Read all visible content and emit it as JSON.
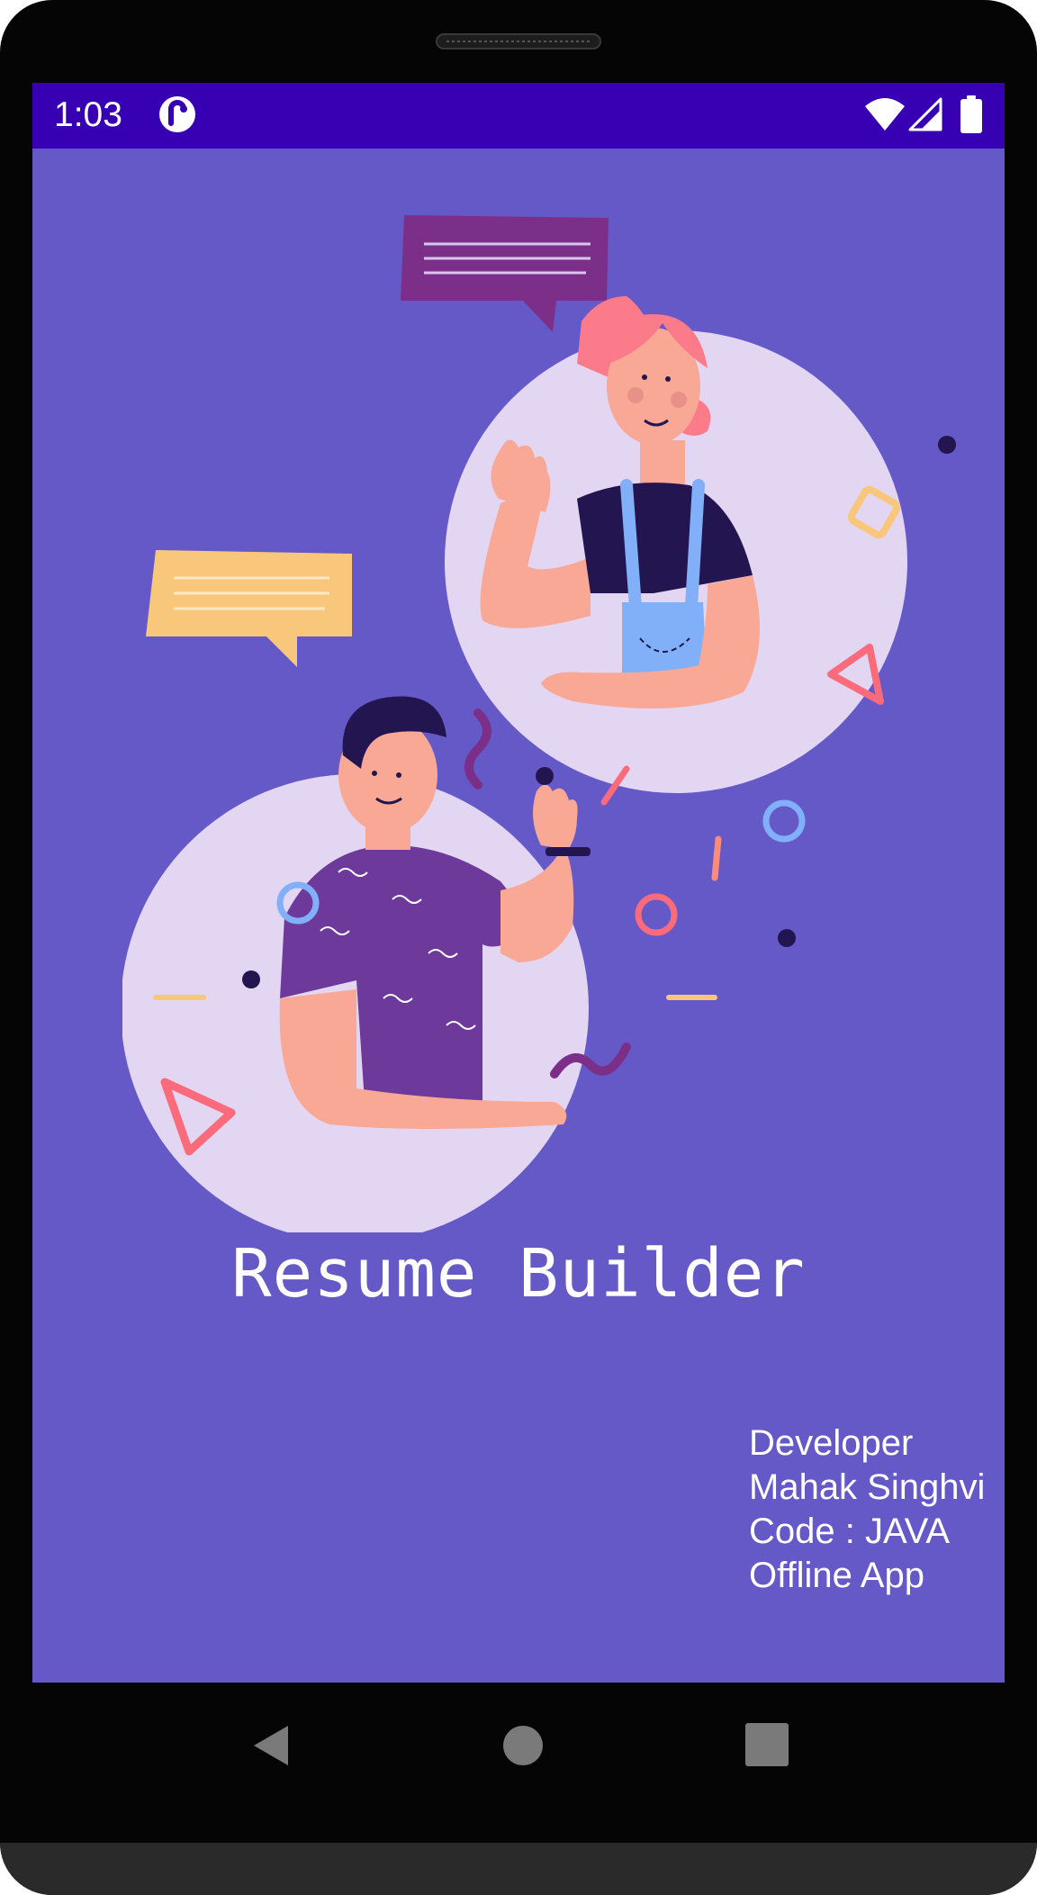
{
  "status_bar": {
    "time": "1:03",
    "icons": [
      "app-notification-icon",
      "wifi-icon",
      "cell-signal-icon",
      "battery-icon"
    ],
    "background": "#3700b3"
  },
  "splash": {
    "background": "#6559c8",
    "title": "Resume Builder",
    "developer_info": [
      "Developer",
      "Mahak Singhvi",
      "Code : JAVA",
      "Offline App"
    ]
  },
  "navigation_bar": {
    "buttons": [
      "back-icon",
      "home-icon",
      "recents-icon"
    ]
  }
}
